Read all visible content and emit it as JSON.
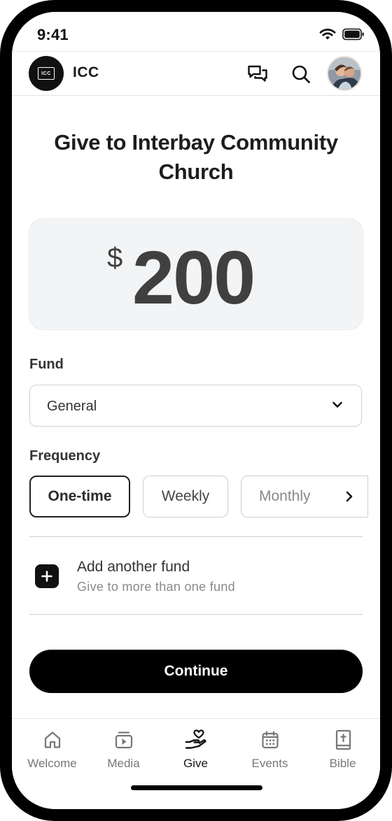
{
  "status_bar": {
    "time": "9:41",
    "icons": [
      "wifi-icon",
      "battery-icon"
    ]
  },
  "app_bar": {
    "logo_text": "ICC",
    "org_short_name": "ICC",
    "icons": [
      "chat-icon",
      "search-icon",
      "avatar"
    ]
  },
  "main": {
    "title": "Give to Interbay Community Church",
    "amount": {
      "currency_symbol": "$",
      "value": "200"
    },
    "fund": {
      "label": "Fund",
      "selected": "General"
    },
    "frequency": {
      "label": "Frequency",
      "options": [
        "One-time",
        "Weekly",
        "Monthly"
      ],
      "selected": "One-time"
    },
    "add_fund": {
      "title": "Add another fund",
      "subtitle": "Give to more than one fund"
    },
    "continue_label": "Continue"
  },
  "tab_bar": {
    "active": "Give",
    "items": [
      {
        "label": "Welcome",
        "icon": "home-icon"
      },
      {
        "label": "Media",
        "icon": "media-icon"
      },
      {
        "label": "Give",
        "icon": "give-icon"
      },
      {
        "label": "Events",
        "icon": "calendar-icon"
      },
      {
        "label": "Bible",
        "icon": "bible-icon"
      }
    ]
  },
  "colors": {
    "accent": "#000000",
    "amount_text": "#404040",
    "amount_bg": "#f3f4f5"
  }
}
